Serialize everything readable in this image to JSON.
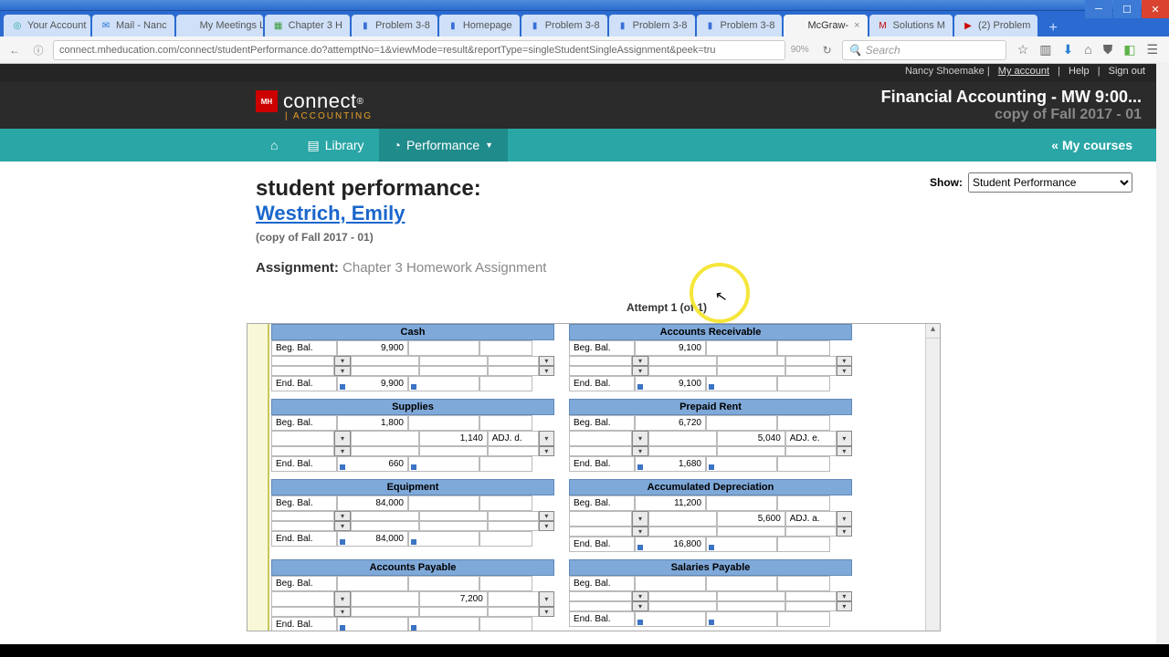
{
  "tabs": [
    {
      "label": "Your Account",
      "fav": "◎",
      "color": "#2aa6a6"
    },
    {
      "label": "Mail - Nanc",
      "fav": "✉",
      "color": "#1e6fd6"
    },
    {
      "label": "My Meetings List",
      "fav": "",
      "color": "#888"
    },
    {
      "label": "Chapter 3 H",
      "fav": "▦",
      "color": "#3a9b3a"
    },
    {
      "label": "Problem 3-8",
      "fav": "▮",
      "color": "#3a6fd6"
    },
    {
      "label": "Homepage",
      "fav": "▮",
      "color": "#3a6fd6"
    },
    {
      "label": "Problem 3-8",
      "fav": "▮",
      "color": "#3a6fd6"
    },
    {
      "label": "Problem 3-8",
      "fav": "▮",
      "color": "#3a6fd6"
    },
    {
      "label": "Problem 3-8",
      "fav": "▮",
      "color": "#3a6fd6"
    },
    {
      "label": "McGraw-",
      "fav": "",
      "color": "#cc0000",
      "active": true
    },
    {
      "label": "Solutions M",
      "fav": "M",
      "color": "#cc0000"
    },
    {
      "label": "(2) Problem",
      "fav": "▶",
      "color": "#cc0000"
    }
  ],
  "url": "connect.mheducation.com/connect/studentPerformance.do?attemptNo=1&viewMode=result&reportType=singleStudentSingleAssignment&peek=tru",
  "zoom": "90%",
  "search_placeholder": "Search",
  "utility": {
    "user": "Nancy Shoemake",
    "myaccount": "My account",
    "help": "Help",
    "signout": "Sign out"
  },
  "brand": {
    "connect": "connect",
    "reg": "®",
    "sub": "| ACCOUNTING",
    "logo": "Mc Graw Hill"
  },
  "course": {
    "line1": "Financial Accounting - MW 9:00...",
    "line2": "copy of Fall 2017 - 01"
  },
  "nav": {
    "library": "Library",
    "performance": "Performance",
    "mycourses": "« My courses"
  },
  "page": {
    "title": "student performance:",
    "student": "Westrich, Emily",
    "copy": "(copy of Fall 2017 - 01)",
    "assign_label": "Assignment:",
    "assign_name": "Chapter 3 Homework Assignment",
    "show_label": "Show:",
    "show_option": "Student Performance",
    "attempt": "Attempt 1 (of 1)"
  },
  "rows": {
    "beg": "Beg. Bal.",
    "end": "End. Bal."
  },
  "accounts": [
    {
      "left": {
        "title": "Cash",
        "beg": "9,900",
        "end": "9,900",
        "adj_amt": "",
        "adj_lab": ""
      },
      "right": {
        "title": "Accounts Receivable",
        "beg": "9,100",
        "end": "9,100",
        "adj_amt": "",
        "adj_lab": ""
      }
    },
    {
      "left": {
        "title": "Supplies",
        "beg": "1,800",
        "end": "660",
        "adj_amt": "1,140",
        "adj_lab": "ADJ. d."
      },
      "right": {
        "title": "Prepaid Rent",
        "beg": "6,720",
        "end": "1,680",
        "adj_amt": "5,040",
        "adj_lab": "ADJ. e."
      }
    },
    {
      "left": {
        "title": "Equipment",
        "beg": "84,000",
        "end": "84,000",
        "adj_amt": "",
        "adj_lab": ""
      },
      "right": {
        "title": "Accumulated Depreciation",
        "beg": "11,200",
        "end": "16,800",
        "adj_amt": "5,600",
        "adj_lab": "ADJ. a."
      }
    },
    {
      "left": {
        "title": "Accounts Payable",
        "beg": "",
        "end": "",
        "adj_amt": "7,200",
        "adj_lab": ""
      },
      "right": {
        "title": "Salaries Payable",
        "beg": "",
        "end": "",
        "adj_amt": "",
        "adj_lab": ""
      }
    }
  ]
}
